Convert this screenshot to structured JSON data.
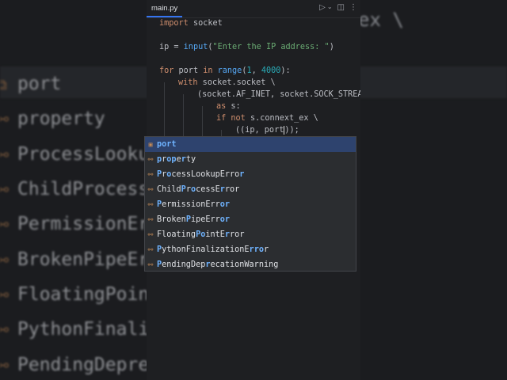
{
  "background": {
    "code_lines": [
      "ex \\"
    ],
    "items": [
      {
        "text": "port",
        "icon": "variable-icon"
      },
      {
        "text": "property",
        "icon": "class-icon"
      },
      {
        "text": "ProcessLookupError",
        "icon": "class-icon"
      },
      {
        "text": "ChildProcessError",
        "icon": "class-icon"
      },
      {
        "text": "PermissionError",
        "icon": "class-icon"
      },
      {
        "text": "BrokenPipeError",
        "icon": "class-icon"
      },
      {
        "text": "FloatingPointError",
        "icon": "class-icon"
      },
      {
        "text": "PythonFinalizationError",
        "icon": "class-icon"
      },
      {
        "text": "PendingDeprecationWarning",
        "icon": "class-icon"
      }
    ]
  },
  "editor": {
    "tab_label": "main.py",
    "toolbar_icons": [
      "run-icon",
      "chevron-down-icon",
      "split-icon",
      "more-icon"
    ],
    "lines": {
      "l1": "import socket",
      "l2": "ip = input(\"Enter the IP address: \")",
      "l3": "for port in range(1, 4000):",
      "l4": "with socket.socket \\",
      "l5": "(socket.AF_INET, socket.SOCK_STREA",
      "l6": "as s:",
      "l7": "if not s.connext_ex \\",
      "l8": "((ip, port));"
    }
  },
  "completion": {
    "typed": "port",
    "items": [
      {
        "text": "port",
        "icon": "variable-icon",
        "selected": true
      },
      {
        "text": "property",
        "icon": "class-icon"
      },
      {
        "text": "ProcessLookupError",
        "icon": "class-icon"
      },
      {
        "text": "ChildProcessError",
        "icon": "class-icon"
      },
      {
        "text": "PermissionError",
        "icon": "class-icon"
      },
      {
        "text": "BrokenPipeError",
        "icon": "class-icon"
      },
      {
        "text": "FloatingPointError",
        "icon": "class-icon"
      },
      {
        "text": "PythonFinalizationError",
        "icon": "class-icon"
      },
      {
        "text": "PendingDeprecationWarning",
        "icon": "class-icon"
      }
    ]
  },
  "colors": {
    "keyword": "#cf8e6d",
    "function": "#56a8f5",
    "string": "#6aab73",
    "number": "#2aacb8",
    "match_highlight": "#6fb3ff",
    "selection": "#2e436e"
  }
}
